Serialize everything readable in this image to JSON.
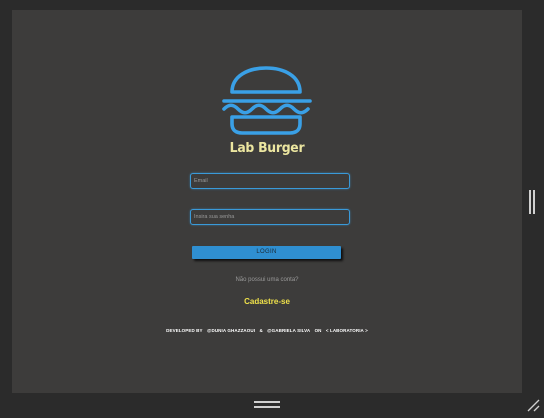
{
  "app": {
    "brand_name": "Lab Burger",
    "logo_icon": "burger-icon",
    "logo_color": "#3aa0e6",
    "brand_color": "#ece6a0"
  },
  "form": {
    "email_placeholder": "Email",
    "password_placeholder": "Insira sua senha",
    "login_label": "LOGIN"
  },
  "signup": {
    "prompt": "Não possui uma conta?",
    "link_label": "Cadastre-se",
    "link_color": "#f0e24a"
  },
  "footer": {
    "developed_by": "DEVELOPED BY",
    "dev1": "@DUNIA GHAZZAOUI",
    "and": "&",
    "dev2": "@GABRIELA SILVA",
    "on": "ON",
    "org": "< LABORATORIA >"
  },
  "chrome": {
    "side_handle_icon": "drag-handle-vertical-icon",
    "bottom_handle_icon": "drag-handle-horizontal-icon",
    "resize_icon": "resize-corner-icon"
  }
}
